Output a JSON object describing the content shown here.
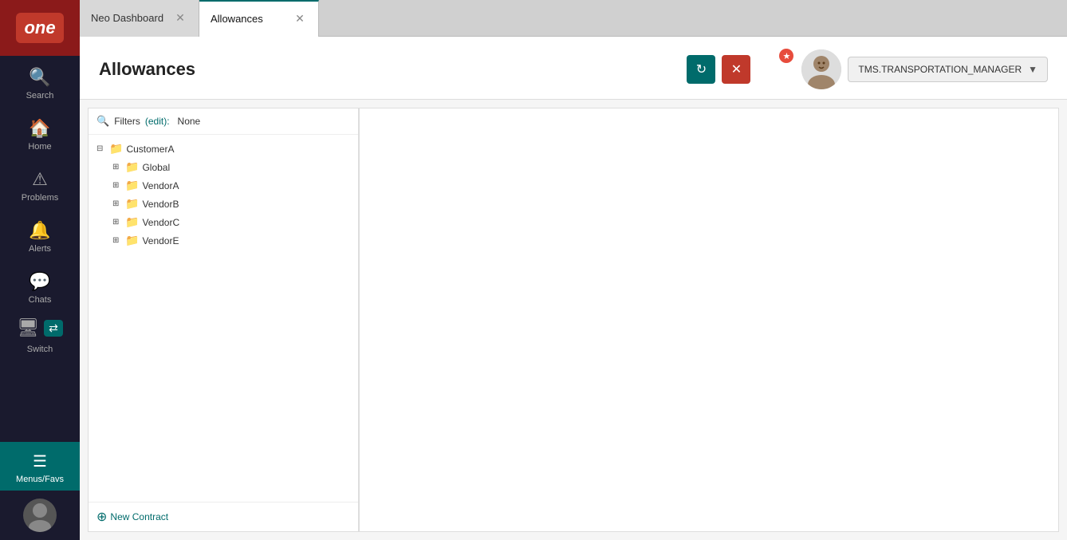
{
  "app": {
    "logo_text": "one"
  },
  "sidebar": {
    "items": [
      {
        "id": "search",
        "label": "Search",
        "icon": "🔍"
      },
      {
        "id": "home",
        "label": "Home",
        "icon": "🏠"
      },
      {
        "id": "problems",
        "label": "Problems",
        "icon": "⚠"
      },
      {
        "id": "alerts",
        "label": "Alerts",
        "icon": "🔔"
      },
      {
        "id": "chats",
        "label": "Chats",
        "icon": "💬"
      },
      {
        "id": "switch",
        "label": "Switch",
        "icon": "📥"
      }
    ],
    "menus_label": "Menus/Favs",
    "menus_icon": "☰"
  },
  "tabs": [
    {
      "id": "neo-dashboard",
      "label": "Neo Dashboard",
      "active": false
    },
    {
      "id": "allowances",
      "label": "Allowances",
      "active": true
    }
  ],
  "header": {
    "title": "Allowances",
    "refresh_label": "↻",
    "close_label": "✕",
    "user_name": "TMS.TRANSPORTATION_MANAGER"
  },
  "filters": {
    "label": "Filters",
    "edit_label": "(edit):",
    "value": "None"
  },
  "tree": {
    "root": {
      "label": "CustomerA",
      "expanded": true,
      "children": [
        {
          "label": "Global",
          "expanded": false,
          "children": []
        },
        {
          "label": "VendorA",
          "expanded": false,
          "children": []
        },
        {
          "label": "VendorB",
          "expanded": false,
          "children": []
        },
        {
          "label": "VendorC",
          "expanded": false,
          "children": []
        },
        {
          "label": "VendorE",
          "expanded": false,
          "children": []
        }
      ]
    }
  },
  "footer": {
    "new_contract_label": "New Contract",
    "plus_icon": "⊕"
  }
}
